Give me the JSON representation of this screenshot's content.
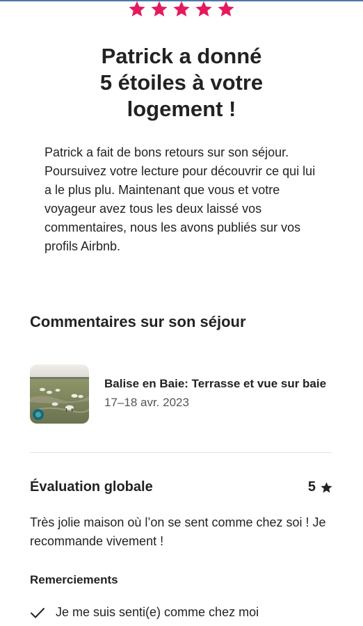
{
  "header": {
    "star_count": 5,
    "star_color": "#e5195e",
    "headline_lines": [
      "Patrick a donné",
      "5 étoiles à votre",
      "logement !"
    ]
  },
  "intro": {
    "text": "Patrick a fait de bons retours sur son séjour. Poursuivez votre lecture pour découvrir ce qui lui a le plus plu. Maintenant que vous et votre voyageur avez tous les deux laissé vos commentaires, nous les avons publiés sur vos profils Airbnb."
  },
  "feedback": {
    "section_title": "Commentaires sur son séjour",
    "listing": {
      "name": "Balise en Baie: Terrasse et vue sur baie",
      "dates": "17–18 avr. 2023",
      "thumbnail": "sheep-on-salt-marsh-photo"
    }
  },
  "overall": {
    "label": "Évaluation globale",
    "score": "5",
    "score_icon": "star-icon",
    "review": "Très jolie maison où l’on se sent comme chez soi ! Je recommande vivement !"
  },
  "thanks": {
    "title": "Remerciements",
    "items": [
      {
        "icon": "checkmark-icon",
        "label": "Je me suis senti(e) comme chez moi"
      }
    ]
  },
  "colors": {
    "accent": "#e5195e",
    "text": "#222222",
    "muted": "#555555",
    "divider": "#e2e2e2",
    "top_rule": "#4a78a8"
  }
}
